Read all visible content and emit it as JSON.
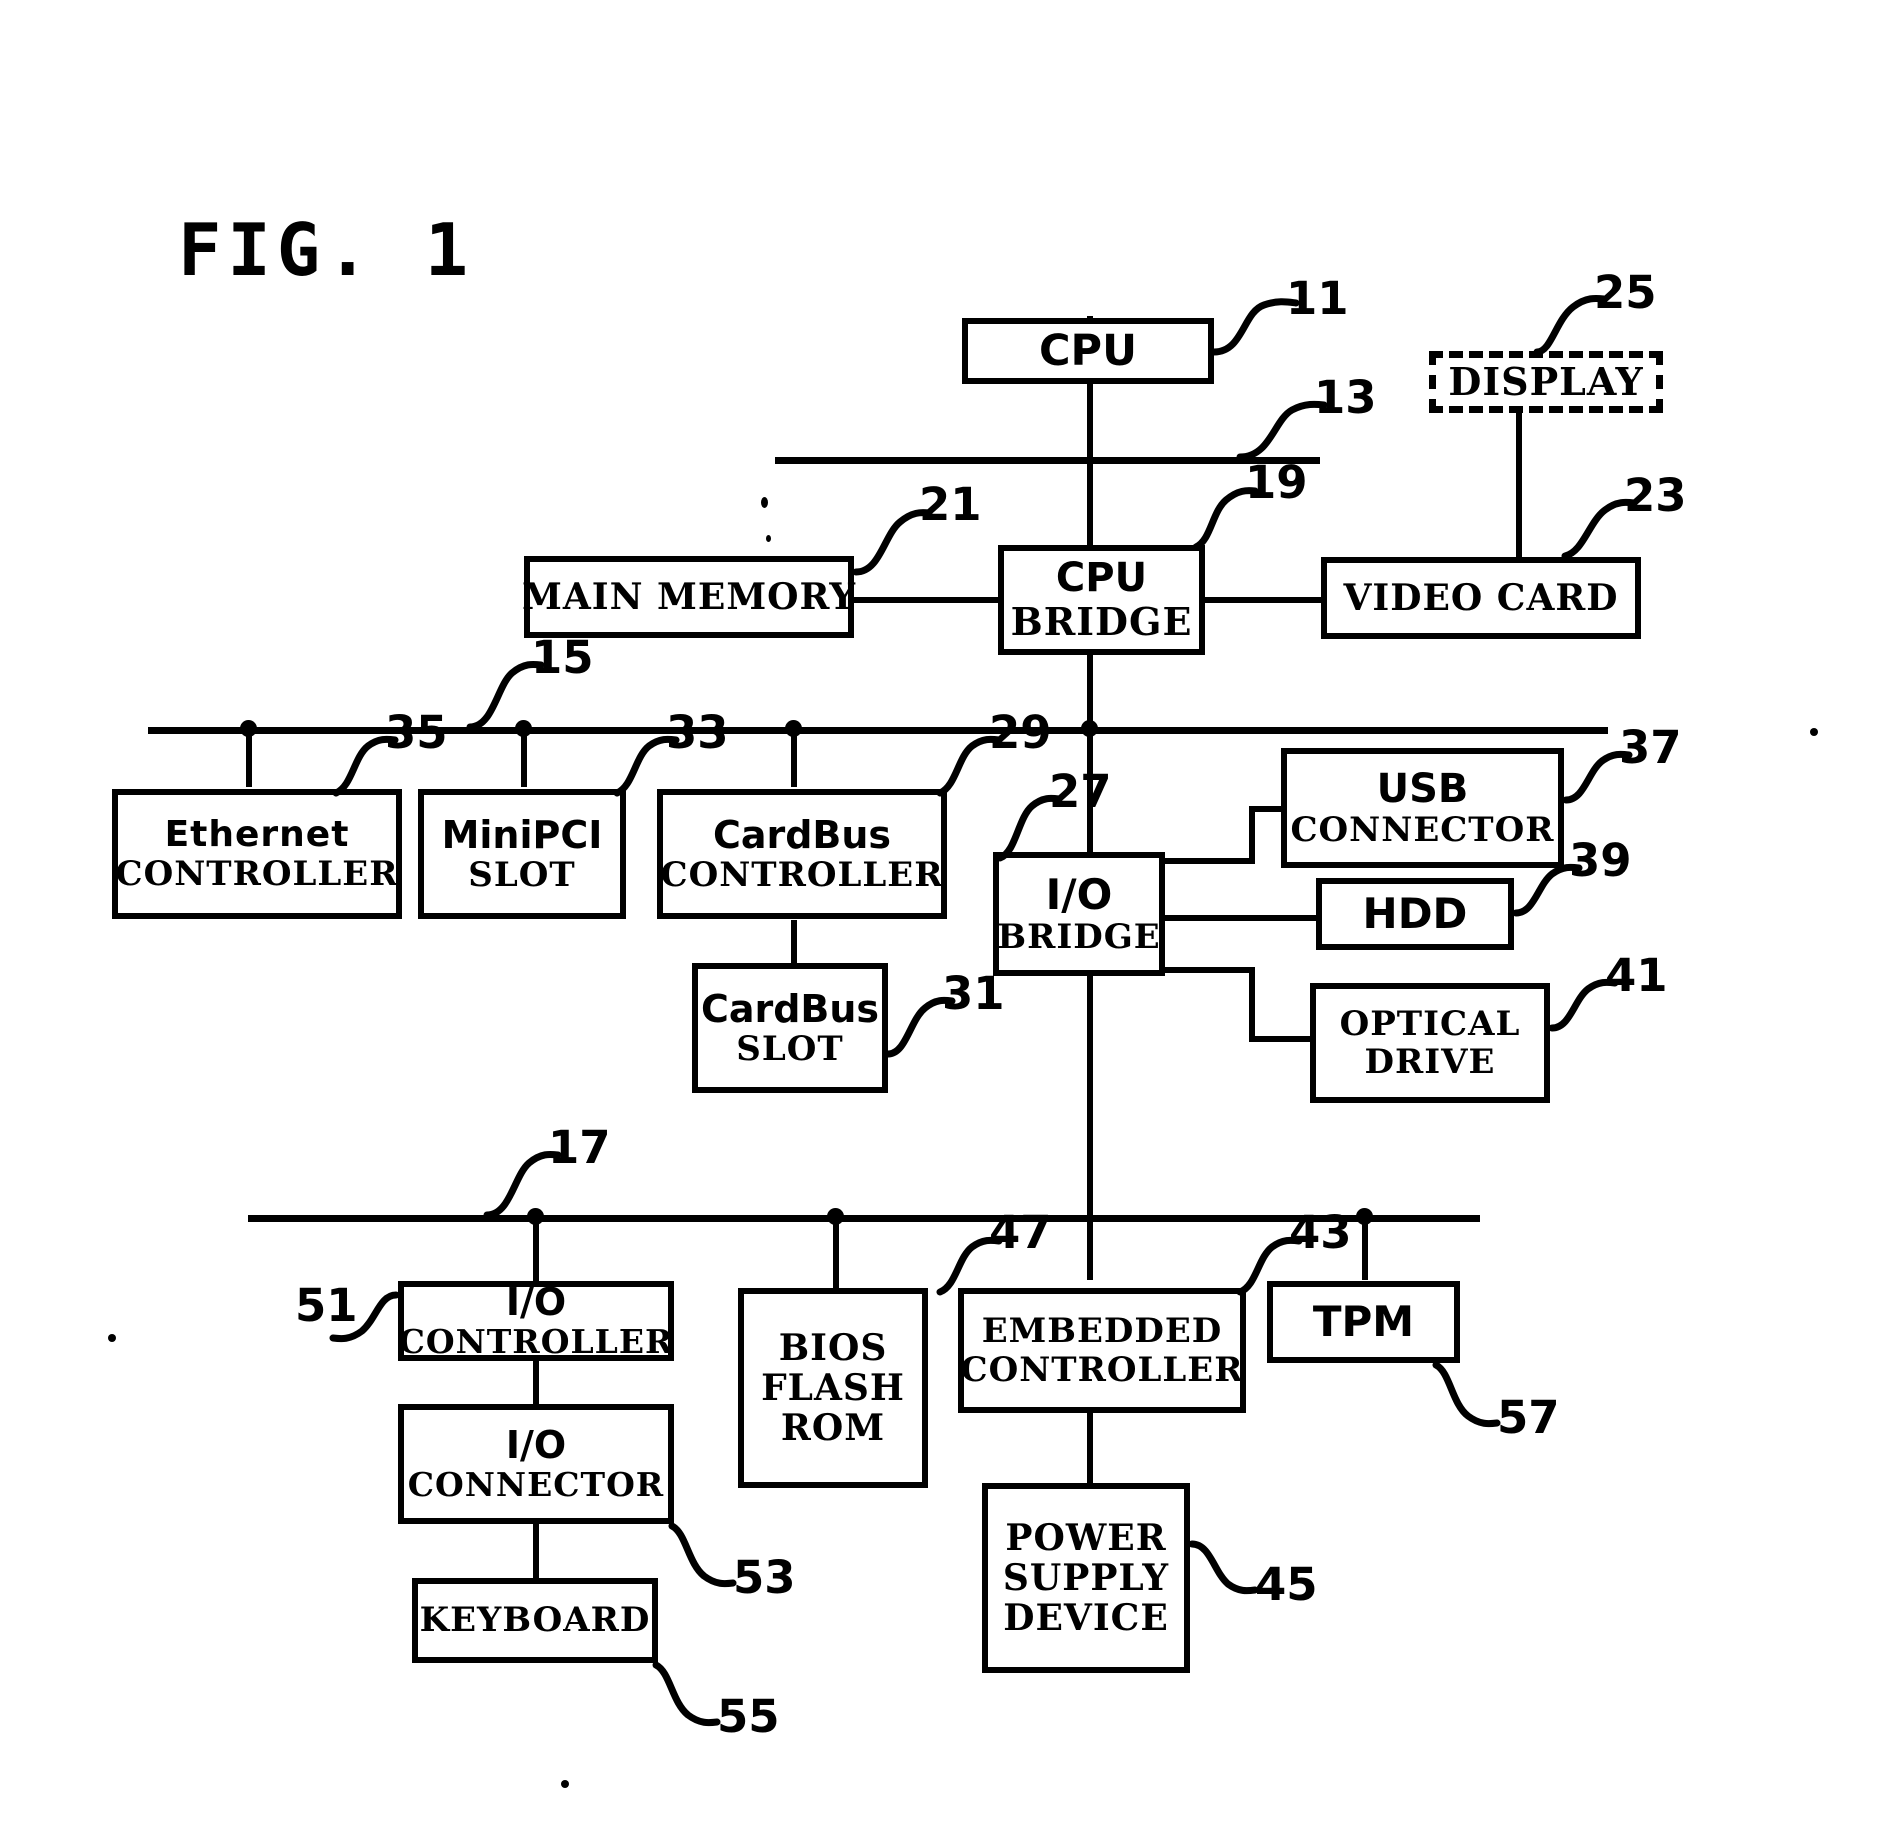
{
  "figure": {
    "title": "FIG. 1",
    "kind": "patent-block-diagram",
    "background": "#ffffff",
    "ink": "#000000"
  },
  "blocks": {
    "cpu": {
      "lines": [
        "CPU"
      ],
      "ref": "11"
    },
    "display": {
      "lines": [
        "DISPLAY"
      ],
      "ref": "25",
      "style": "dashed"
    },
    "main_memory": {
      "lines": [
        "MAIN MEMORY"
      ],
      "ref": "21"
    },
    "cpu_bridge": {
      "lines": [
        "CPU",
        "BRIDGE"
      ],
      "ref": "19"
    },
    "video_card": {
      "lines": [
        "VIDEO CARD"
      ],
      "ref": "23"
    },
    "ethernet": {
      "lines": [
        "Ethernet",
        "CONTROLLER"
      ],
      "ref": "35"
    },
    "minipci": {
      "lines": [
        "MiniPCI",
        "SLOT"
      ],
      "ref": "33"
    },
    "cardbus_ctrl": {
      "lines": [
        "CardBus",
        "CONTROLLER"
      ],
      "ref": "29"
    },
    "cardbus_slot": {
      "lines": [
        "CardBus",
        "SLOT"
      ],
      "ref": "31"
    },
    "io_bridge": {
      "lines": [
        "I/O",
        "BRIDGE"
      ],
      "ref": "27"
    },
    "usb_connector": {
      "lines": [
        "USB",
        "CONNECTOR"
      ],
      "ref": "37"
    },
    "hdd": {
      "lines": [
        "HDD"
      ],
      "ref": "39"
    },
    "optical_drive": {
      "lines": [
        "OPTICAL",
        "DRIVE"
      ],
      "ref": "41"
    },
    "io_controller": {
      "lines": [
        "I/O",
        "CONTROLLER"
      ],
      "ref": "51"
    },
    "io_connector": {
      "lines": [
        "I/O",
        "CONNECTOR"
      ],
      "ref": "53"
    },
    "keyboard": {
      "lines": [
        "KEYBOARD"
      ],
      "ref": "55"
    },
    "bios_flash_rom": {
      "lines": [
        "BIOS",
        "FLASH",
        "ROM"
      ],
      "ref": "47"
    },
    "embedded_ctrl": {
      "lines": [
        "EMBEDDED",
        "CONTROLLER"
      ],
      "ref": "43"
    },
    "tpm": {
      "lines": [
        "TPM"
      ],
      "ref": "57"
    },
    "power_supply": {
      "lines": [
        "POWER",
        "SUPPLY",
        "DEVICE"
      ],
      "ref": "45"
    }
  },
  "buses": {
    "cpu_bus": {
      "ref": "13"
    },
    "pci_bus": {
      "ref": "15"
    },
    "lpc_bus": {
      "ref": "17"
    }
  },
  "reference_numerals": [
    "11",
    "13",
    "15",
    "17",
    "19",
    "21",
    "23",
    "25",
    "27",
    "29",
    "31",
    "33",
    "35",
    "37",
    "39",
    "41",
    "43",
    "45",
    "47",
    "51",
    "53",
    "55",
    "57"
  ]
}
